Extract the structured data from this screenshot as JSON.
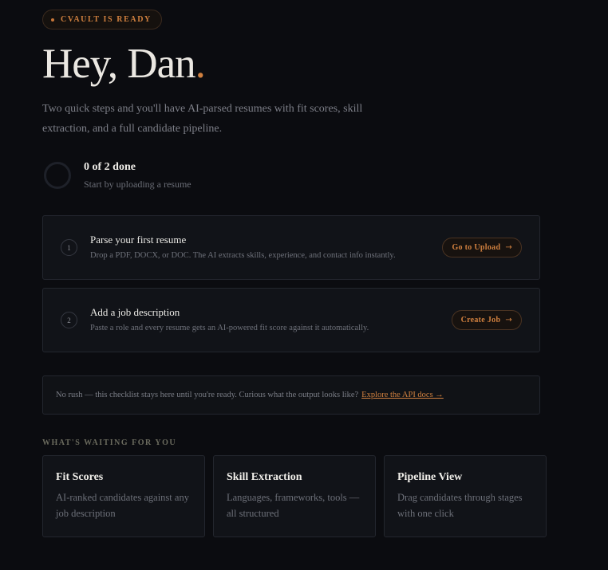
{
  "badge": {
    "label": "CVAULT IS READY"
  },
  "greeting": {
    "text": "Hey, Dan",
    "period": "."
  },
  "intro": "Two quick steps and you'll have AI-parsed resumes with fit scores, skill extraction, and a full candidate pipeline.",
  "progress": {
    "count": "0 of 2 done",
    "hint": "Start by uploading a resume",
    "completed": 0,
    "total": 2
  },
  "steps": [
    {
      "number": "1",
      "title": "Parse your first resume",
      "description": "Drop a PDF, DOCX, or DOC. The AI extracts skills, experience, and contact info instantly.",
      "button": "Go to Upload",
      "arrow": "→"
    },
    {
      "number": "2",
      "title": "Add a job description",
      "description": "Paste a role and every resume gets an AI-powered fit score against it automatically.",
      "button": "Create Job",
      "arrow": "→"
    }
  ],
  "note": {
    "text": "No rush — this checklist stays here until you're ready. Curious what the output looks like?",
    "link": "Explore the API docs →"
  },
  "waiting": {
    "label": "WHAT'S WAITING FOR YOU",
    "cards": [
      {
        "title": "Fit Scores",
        "description": "AI-ranked candidates against any job description"
      },
      {
        "title": "Skill Extraction",
        "description": "Languages, frameworks, tools — all structured"
      },
      {
        "title": "Pipeline View",
        "description": "Drag candidates through stages with one click"
      }
    ]
  },
  "colors": {
    "accent": "#d0803f",
    "background": "#0b0c10",
    "card": "#111318"
  }
}
